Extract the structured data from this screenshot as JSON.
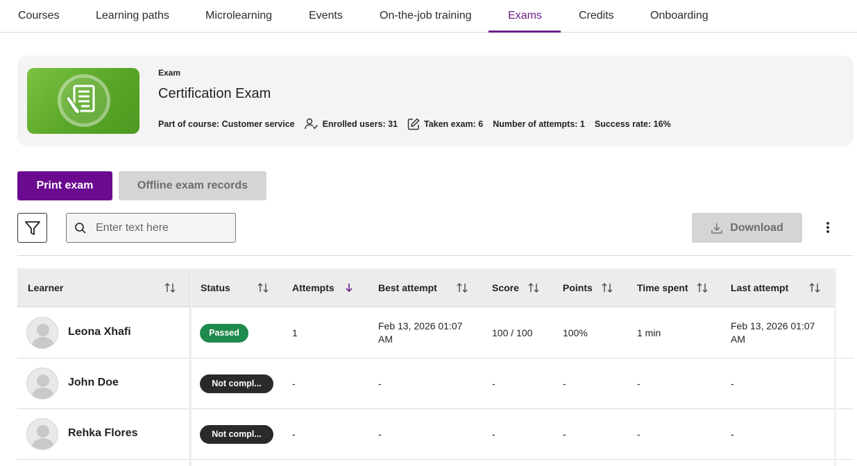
{
  "tabs": [
    {
      "label": "Courses",
      "active": false
    },
    {
      "label": "Learning paths",
      "active": false
    },
    {
      "label": "Microlearning",
      "active": false
    },
    {
      "label": "Events",
      "active": false
    },
    {
      "label": "On-the-job training",
      "active": false
    },
    {
      "label": "Exams",
      "active": true
    },
    {
      "label": "Credits",
      "active": false
    },
    {
      "label": "Onboarding",
      "active": false
    }
  ],
  "exam": {
    "kicker": "Exam",
    "title": "Certification Exam",
    "course": "Part of course: Customer service",
    "enrolled": "Enrolled users: 31",
    "taken": "Taken exam: 6",
    "attempts": "Number of attempts: 1",
    "success_rate": "Success rate: 16%",
    "thumb_icon": "exam-document-icon"
  },
  "actions": {
    "print_label": "Print exam",
    "offline_label": "Offline exam records",
    "download_label": "Download",
    "search_placeholder": "Enter text here"
  },
  "table": {
    "columns": [
      {
        "label": "Learner",
        "sort_icon": "sort-icon"
      },
      {
        "label": "Status",
        "sort_icon": "sort-icon"
      },
      {
        "label": "Attempts",
        "sort_icon": "sort-desc-icon"
      },
      {
        "label": "Best attempt",
        "sort_icon": "sort-icon"
      },
      {
        "label": "Score",
        "sort_icon": "sort-icon"
      },
      {
        "label": "Points",
        "sort_icon": "sort-icon"
      },
      {
        "label": "Time spent",
        "sort_icon": "sort-icon"
      },
      {
        "label": "Last attempt",
        "sort_icon": "sort-icon"
      }
    ],
    "rows": [
      {
        "learner": "Leona Xhafi",
        "status": "Passed",
        "status_type": "passed",
        "attempts": "1",
        "best_attempt_line1": "Feb 13, 2026 01:07",
        "best_attempt_line2": "AM",
        "score": "100 / 100",
        "points": "100%",
        "time_spent": "1 min",
        "last_attempt_line1": "Feb 13, 2026 01:07",
        "last_attempt_line2": "AM"
      },
      {
        "learner": "John Doe",
        "status": "Not compl...",
        "status_type": "notcomplete",
        "attempts": "-",
        "best_attempt_line1": "-",
        "best_attempt_line2": "",
        "score": "-",
        "points": "-",
        "time_spent": "-",
        "last_attempt_line1": "-",
        "last_attempt_line2": ""
      },
      {
        "learner": "Rehka Flores",
        "status": "Not compl...",
        "status_type": "notcomplete",
        "attempts": "-",
        "best_attempt_line1": "-",
        "best_attempt_line2": "",
        "score": "-",
        "points": "-",
        "time_spent": "-",
        "last_attempt_line1": "-",
        "last_attempt_line2": ""
      }
    ]
  },
  "colors": {
    "accent": "#6b0a8f",
    "passed": "#1e8a4c",
    "not_complete": "#2a2a2a",
    "thumb_green": "#5aa628"
  }
}
